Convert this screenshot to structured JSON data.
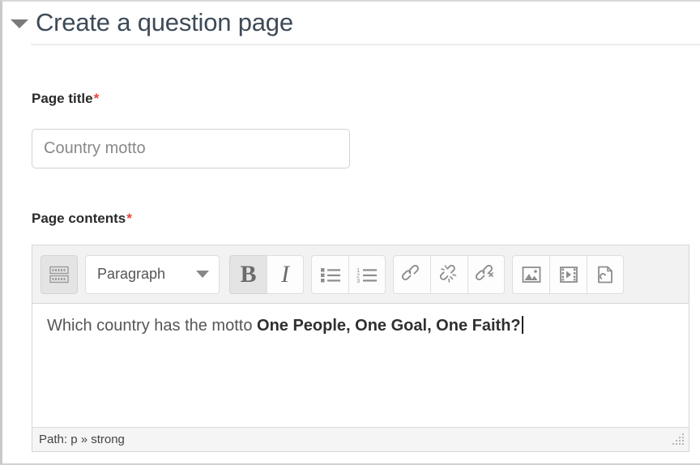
{
  "section": {
    "title": "Create a question page",
    "collapse_icon": "triangle-down-icon",
    "expanded": true
  },
  "fields": {
    "page_title": {
      "label": "Page title",
      "required_marker": "*",
      "value": "Country motto",
      "placeholder": "Country motto"
    },
    "page_contents": {
      "label": "Page contents",
      "required_marker": "*"
    }
  },
  "editor": {
    "toolbar": {
      "toggle_toolbar": {
        "name": "show-more-buttons-icon",
        "title": "Show more buttons",
        "pressed": false
      },
      "format_select": {
        "value": "Paragraph",
        "caret_icon": "chevron-down-icon"
      },
      "buttons": [
        {
          "name": "bold-button",
          "glyph": "B",
          "title": "Bold",
          "pressed": true
        },
        {
          "name": "italic-button",
          "glyph": "I",
          "title": "Italic",
          "pressed": false
        },
        {
          "name": "bullet-list-button",
          "icon": "bullet-list-icon",
          "title": "Bulleted list",
          "pressed": false
        },
        {
          "name": "numbered-list-button",
          "icon": "numbered-list-icon",
          "title": "Numbered list",
          "pressed": false
        },
        {
          "name": "link-button",
          "icon": "link-icon",
          "title": "Link",
          "pressed": false
        },
        {
          "name": "unlink-button",
          "icon": "unlink-icon",
          "title": "Unlink",
          "pressed": false
        },
        {
          "name": "anchor-button",
          "icon": "anchor-icon",
          "title": "Anchor",
          "pressed": false
        },
        {
          "name": "image-button",
          "icon": "image-icon",
          "title": "Image",
          "pressed": false
        },
        {
          "name": "media-button",
          "icon": "media-icon",
          "title": "Media",
          "pressed": false
        },
        {
          "name": "manage-files-button",
          "icon": "file-manager-icon",
          "title": "Manage files",
          "pressed": false
        }
      ]
    },
    "content": {
      "plain_prefix": "Which country has the motto ",
      "bold_text": "One People, One Goal, One Faith?",
      "caret_visible": true
    },
    "status": {
      "path_label": "Path:",
      "path_value": "p » strong",
      "full": "Path: p » strong",
      "resize_handle_icon": "resize-grip-icon"
    }
  },
  "colors": {
    "required_asterisk": "#e8443a",
    "title_text": "#3d4a57",
    "toolbar_bg": "#f2f2f2",
    "status_bg": "#f5f5f5",
    "border": "#d6d6d6"
  }
}
